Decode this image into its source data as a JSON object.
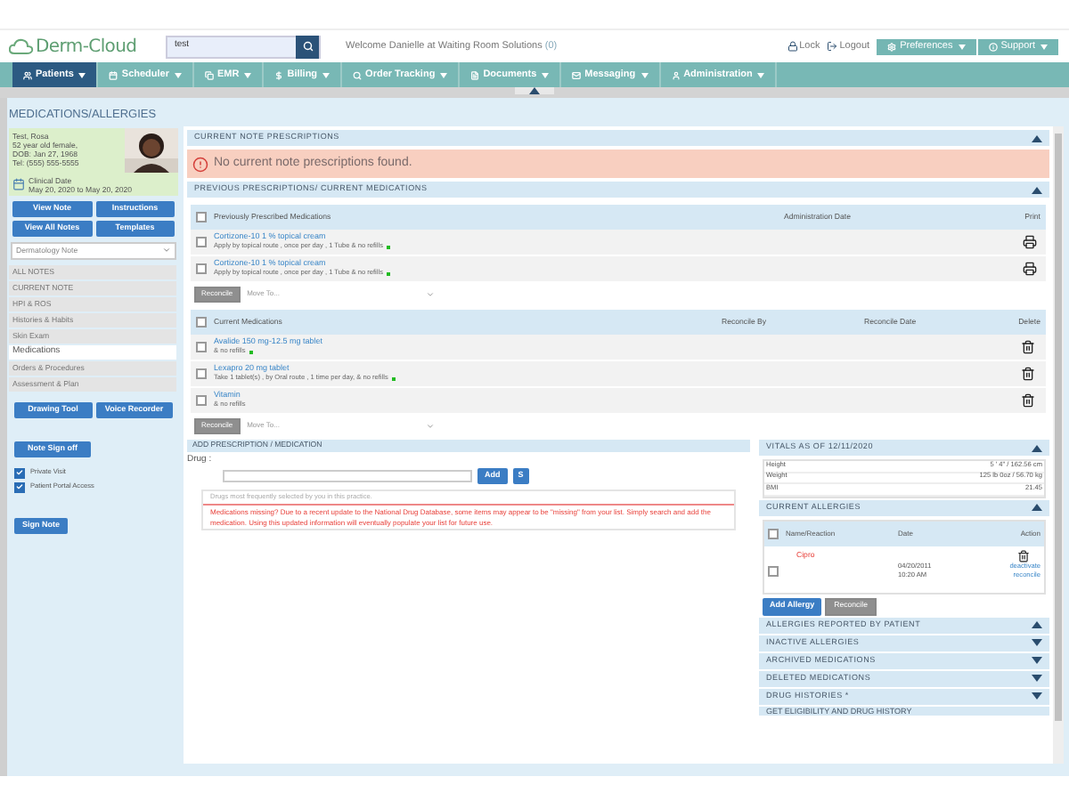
{
  "header": {
    "logo": "Derm-Cloud",
    "search_value": "test",
    "welcome": "Welcome Danielle at Waiting Room Solutions",
    "welcome_count": "(0)",
    "links": [
      {
        "label": "Lock",
        "kind": "lock"
      },
      {
        "label": "Logout",
        "kind": "logout"
      }
    ],
    "buttons": [
      {
        "label": "Preferences",
        "kind": "gear"
      },
      {
        "label": "Support",
        "kind": "info"
      }
    ]
  },
  "nav": [
    {
      "label": "Patients",
      "kind": "users",
      "selected": true
    },
    {
      "label": "Scheduler",
      "kind": "calendar",
      "selected": false
    },
    {
      "label": "EMR",
      "kind": "copy",
      "selected": false
    },
    {
      "label": "Billing",
      "kind": "dollar",
      "selected": false
    },
    {
      "label": "Order Tracking",
      "kind": "search",
      "selected": false
    },
    {
      "label": "Documents",
      "kind": "file",
      "selected": false
    },
    {
      "label": "Messaging",
      "kind": "mail",
      "selected": false
    },
    {
      "label": "Administration",
      "kind": "user",
      "selected": false
    }
  ],
  "page_title": "MEDICATIONS/ALLERGIES",
  "patient": {
    "lines": [
      "Test, Rosa",
      "52 year old female,",
      "DOB: Jan 27, 1968",
      "Tel: (555) 555-5555"
    ],
    "clinical_date_label": "Clinical Date",
    "clinical_date": "May 20, 2020 to May 20, 2020"
  },
  "note_buttons": [
    "View Note",
    "Instructions",
    "View All Notes",
    "Templates"
  ],
  "note_select": "Dermatology Note",
  "note_sections": [
    {
      "label": "ALL NOTES",
      "selected": false
    },
    {
      "label": "CURRENT NOTE",
      "selected": false
    },
    {
      "label": "HPI & ROS",
      "selected": false
    },
    {
      "label": "Histories & Habits",
      "selected": false
    },
    {
      "label": "Skin Exam",
      "selected": false
    },
    {
      "label": "Medications",
      "selected": true
    },
    {
      "label": "Orders & Procedures",
      "selected": false
    },
    {
      "label": "Assessment & Plan",
      "selected": false
    }
  ],
  "tool_buttons": [
    "Drawing Tool",
    "Voice Recorder",
    "Note Sign off"
  ],
  "options": [
    {
      "label": "Private Visit",
      "checked": true
    },
    {
      "label": "Patient Portal Access",
      "checked": true
    }
  ],
  "sign_button": "Sign Note",
  "current_note": {
    "title": "CURRENT NOTE PRESCRIPTIONS",
    "expanded": true,
    "alert": "No current note prescriptions found."
  },
  "previous": {
    "title": "PREVIOUS PRESCRIPTIONS/ CURRENT MEDICATIONS",
    "expanded": true,
    "all_checked": false,
    "columns": [
      "Previously Prescribed Medications",
      "Administration Date",
      "Print"
    ],
    "rows": [
      {
        "name": "Cortizone-10 1 % topical cream",
        "sig": "Apply by topical route , once per day , 1 Tube & no refills",
        "checked": false,
        "marked": true
      },
      {
        "name": "Cortizone-10 1 % topical cream",
        "sig": "Apply by topical route , once per day , 1 Tube & no refills",
        "checked": false,
        "marked": true
      }
    ],
    "action_button": "Reconcile",
    "move_to": "Move To..."
  },
  "current": {
    "all_checked": false,
    "columns": [
      "Current Medications",
      "Reconcile By",
      "Reconcile Date",
      "Delete"
    ],
    "rows": [
      {
        "name": "Avalide 150 mg-12.5 mg tablet",
        "sig": "& no refills",
        "checked": false,
        "marked": true
      },
      {
        "name": "Lexapro 20 mg tablet",
        "sig": "Take 1 tablet(s) , by Oral route , 1 time per day, & no refills",
        "checked": false,
        "marked": true
      },
      {
        "name": "Vitamin",
        "sig": "& no refills",
        "checked": false,
        "marked": false
      }
    ],
    "action_button": "Reconcile",
    "move_to": "Move To..."
  },
  "add_prescription": {
    "title": "ADD PRESCRIPTION / MEDICATION",
    "drug_label": "Drug :",
    "buttons": [
      "Add",
      "S"
    ],
    "frequent": "Drugs most frequently selected by you in this practice.",
    "warning": "Medications missing? Due to a recent update to the National Drug Database, some items may appear to be \"missing\" from your list. Simply search and add the medication. Using this updated information will eventually populate your list for future use."
  },
  "vitals": {
    "title": "VITALS AS OF 12/11/2020",
    "expanded": true,
    "rows": [
      {
        "label": "Height",
        "value": "5 ' 4\" / 162.56 cm"
      },
      {
        "label": "Weight",
        "value": "125 lb 0oz / 56.70 kg"
      },
      {
        "label": "BMI",
        "value": "21.45"
      }
    ]
  },
  "allergies": {
    "title": "CURRENT ALLERGIES",
    "expanded": true,
    "all_checked": false,
    "columns": [
      "Name/Reaction",
      "Date",
      "Action"
    ],
    "rows": [
      {
        "name": "Cipro",
        "date": "04/20/2011",
        "time": "10:20 AM",
        "actions": [
          "deactivate",
          "reconcile"
        ],
        "checked": false
      }
    ],
    "buttons": [
      "Add Allergy",
      "Reconcile"
    ]
  },
  "sections": [
    {
      "title": "ALLERGIES REPORTED BY PATIENT",
      "expanded": true
    },
    {
      "title": "INACTIVE ALLERGIES",
      "expanded": false
    },
    {
      "title": "ARCHIVED MEDICATIONS",
      "expanded": false
    },
    {
      "title": "DELETED MEDICATIONS",
      "expanded": false
    },
    {
      "title": "DRUG HISTORIES *",
      "expanded": false
    }
  ],
  "partial_section": "GET ELIGIBILITY AND DRUG HISTORY"
}
